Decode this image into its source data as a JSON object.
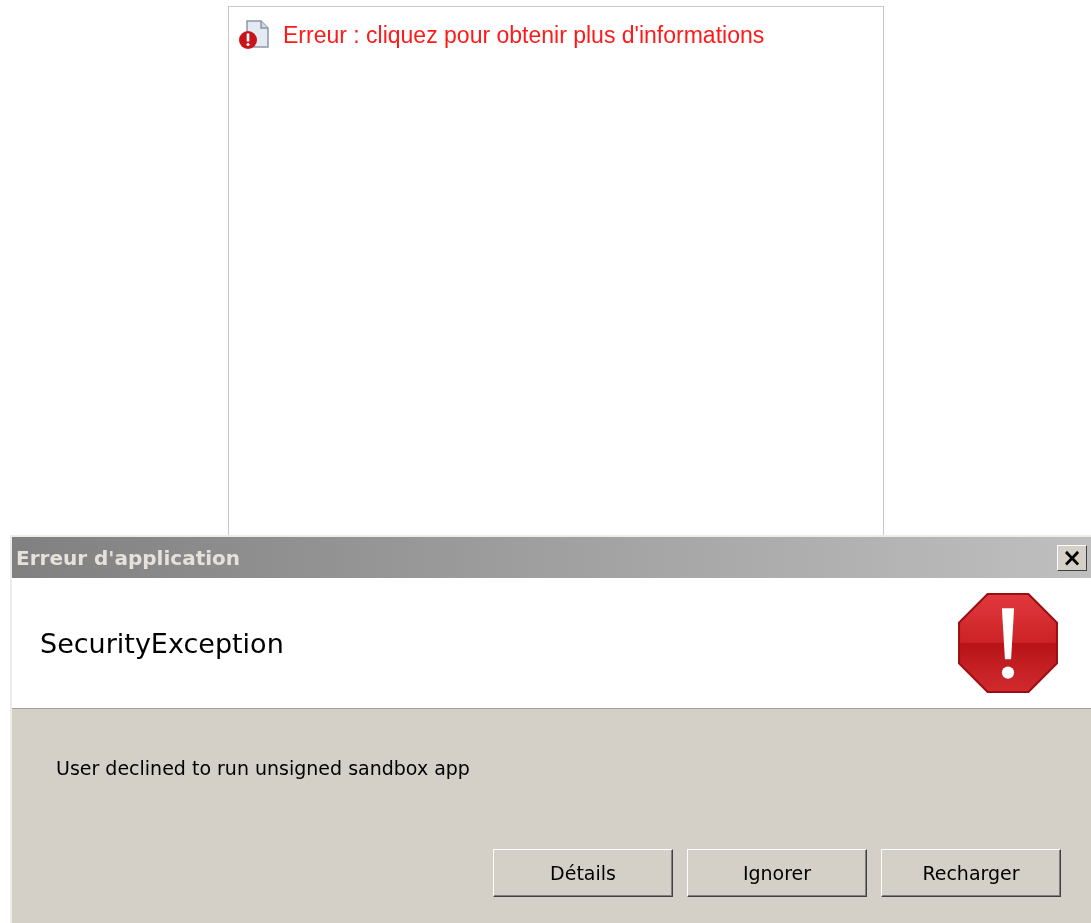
{
  "applet": {
    "error_link": "Erreur : cliquez pour obtenir plus d'informations"
  },
  "dialog": {
    "title": "Erreur d'application",
    "close": "×",
    "heading": "SecurityException",
    "message": "User declined to run unsigned sandbox app",
    "buttons": [
      {
        "label": "Détails"
      },
      {
        "label": "Ignorer"
      },
      {
        "label": "Recharger"
      }
    ]
  }
}
